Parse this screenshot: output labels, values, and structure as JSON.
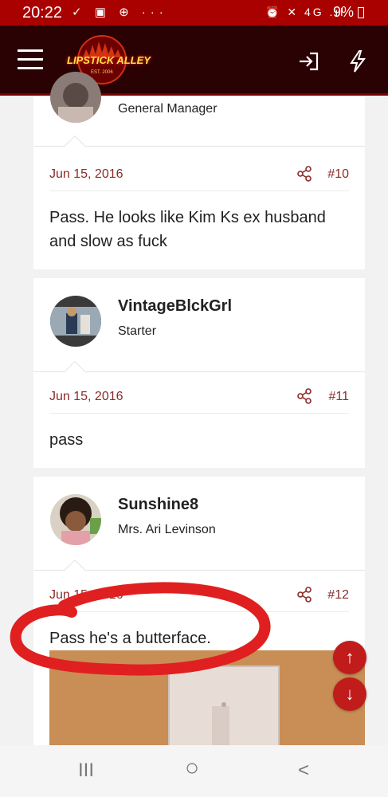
{
  "status_bar": {
    "time": "20:22",
    "left_icons": "✓ ▣ ⊕ ···",
    "right_icons": "⏰ ✕ 4G .ıl",
    "battery": "9%"
  },
  "header": {
    "logo_text": "LIPSTICK ALLEY",
    "logo_sub": "EST. 2006",
    "menu_icon": "hamburger-icon",
    "login_icon": "login-icon",
    "flash_icon": "lightning-icon"
  },
  "posts": [
    {
      "user_title": "General Manager",
      "date": "Jun 15, 2016",
      "number": "#10",
      "text_line1": "Pass. He looks like Kim Ks ex husband",
      "text_line2": "and slow as fuck"
    },
    {
      "username": "VintageBlckGrl",
      "user_title": "Starter",
      "date": "Jun 15, 2016",
      "number": "#11",
      "text": "pass"
    },
    {
      "username": "Sunshine8",
      "user_title": "Mrs. Ari Levinson",
      "date": "Jun 15, 2016",
      "number": "#12",
      "text": "Pass he's a butterface."
    }
  ],
  "fab": {
    "up": "↑",
    "down": "↓"
  },
  "nav": {
    "recents": "III",
    "home": "○",
    "back": "<"
  },
  "colors": {
    "brand_red": "#a90000",
    "link": "#8b2a2a",
    "annotation": "#e02020"
  }
}
